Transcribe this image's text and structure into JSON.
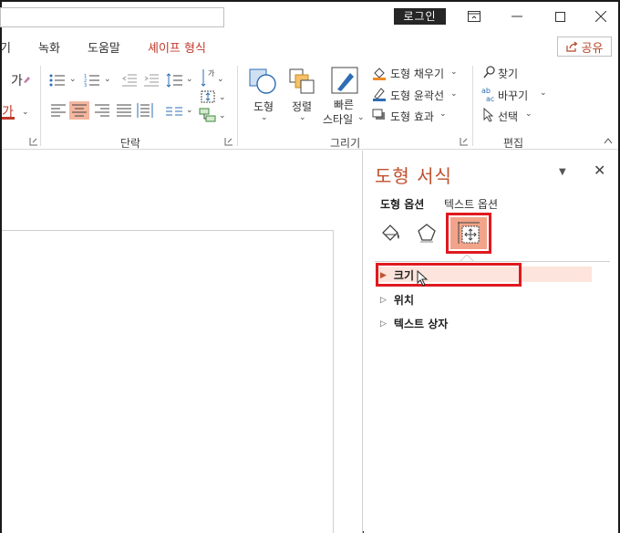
{
  "titlebar": {
    "login_label": "로그인"
  },
  "tabs": [
    {
      "label": "기"
    },
    {
      "label": "녹화"
    },
    {
      "label": "도움말"
    },
    {
      "label": "셰이프 형식"
    }
  ],
  "share_label": "공유",
  "ribbon": {
    "font_char": "가",
    "font_char2": "가",
    "paragraph_label": "단락",
    "drawing_label": "그리기",
    "editing_label": "편집",
    "shape_label": "도형",
    "arrange_label": "정렬",
    "quick_style_label_1": "빠른",
    "quick_style_label_2": "스타일",
    "shape_fill_label": "도형 채우기",
    "shape_outline_label": "도형 윤곽선",
    "shape_effect_label": "도형 효과",
    "find_label": "찾기",
    "replace_label": "바꾸기",
    "select_label": "선택"
  },
  "pane": {
    "title": "도형 서식",
    "tab_shape": "도형 옵션",
    "tab_text": "텍스트 옵션",
    "sections": [
      {
        "label": "크기"
      },
      {
        "label": "위치"
      },
      {
        "label": "텍스트 상자"
      }
    ]
  },
  "colors": {
    "accent": "#c0502e",
    "highlight_red": "#e0191f",
    "active_icon": "#f2a48a",
    "section_highlight": "#fde4dc"
  }
}
